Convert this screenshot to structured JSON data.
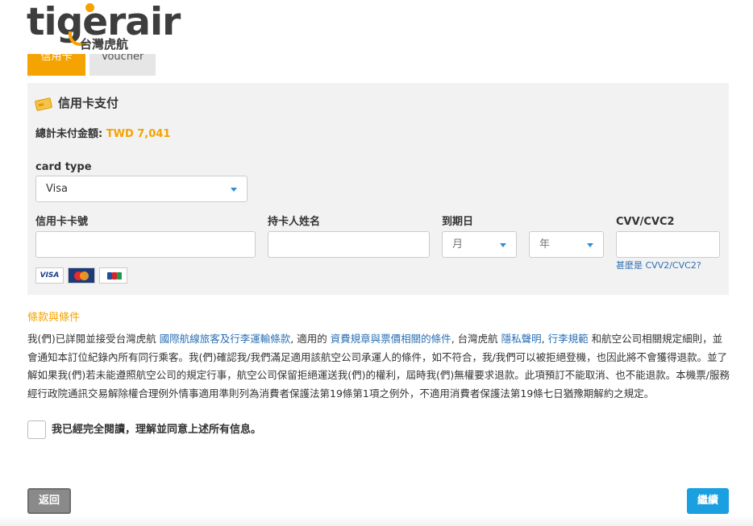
{
  "brand": {
    "name": "tigerair",
    "sub": "台灣虎航",
    "accent": "#f5a300"
  },
  "tabs": [
    {
      "label": "信用卡"
    },
    {
      "label": "Voucher"
    }
  ],
  "payment": {
    "title": "信用卡支付",
    "title_icon": "credit-card-icon",
    "total_label": "總計未付金額:",
    "total_value": "TWD 7,041",
    "card_type_label": "card type",
    "card_type_value": "Visa",
    "card_number_label": "信用卡卡號",
    "holder_label": "持卡人姓名",
    "expiry_label": "到期日",
    "month_value": "月",
    "year_value": "年",
    "cvv_label": "CVV/CVC2",
    "cvv_help": "甚麼是 CVV2/CVC2?",
    "card_logos": [
      "VISA",
      "MasterCard",
      "JCB"
    ]
  },
  "terms": {
    "title": "條款與條件",
    "p1": "我(們)已詳閱並接受台灣虎航 ",
    "link1": "國際航線旅客及行李運輸條款",
    "p2": ", 適用的 ",
    "link2": "資費規章與票價相關的條件",
    "p3": ", 台灣虎航 ",
    "link3": "隱私聲明",
    "p4": ", ",
    "link4": "行李規範",
    "p5": " 和航空公司相關規定細則，並會通知本訂位紀錄內所有同行乘客。我(們)確認我/我們滿足適用該航空公司承運人的條件，如不符合，我/我們可以被拒絕登機，也因此將不會獲得退款。並了解如果我(們)若未能遵照航空公司的規定行事，航空公司保留拒絕運送我(們)的權利，屆時我(們)無權要求退款。此項預訂不能取消、也不能退款。本機票/服務經行政院通訊交易解除權合理例外情事適用準則列為消費者保護法第19條第1項之例外，不適用消費者保護法第19條七日猶豫期解約之規定。",
    "agree_label": "我已經完全閱讀，理解並同意上述所有信息。"
  },
  "buttons": {
    "back": "返回",
    "next": "繼續"
  }
}
